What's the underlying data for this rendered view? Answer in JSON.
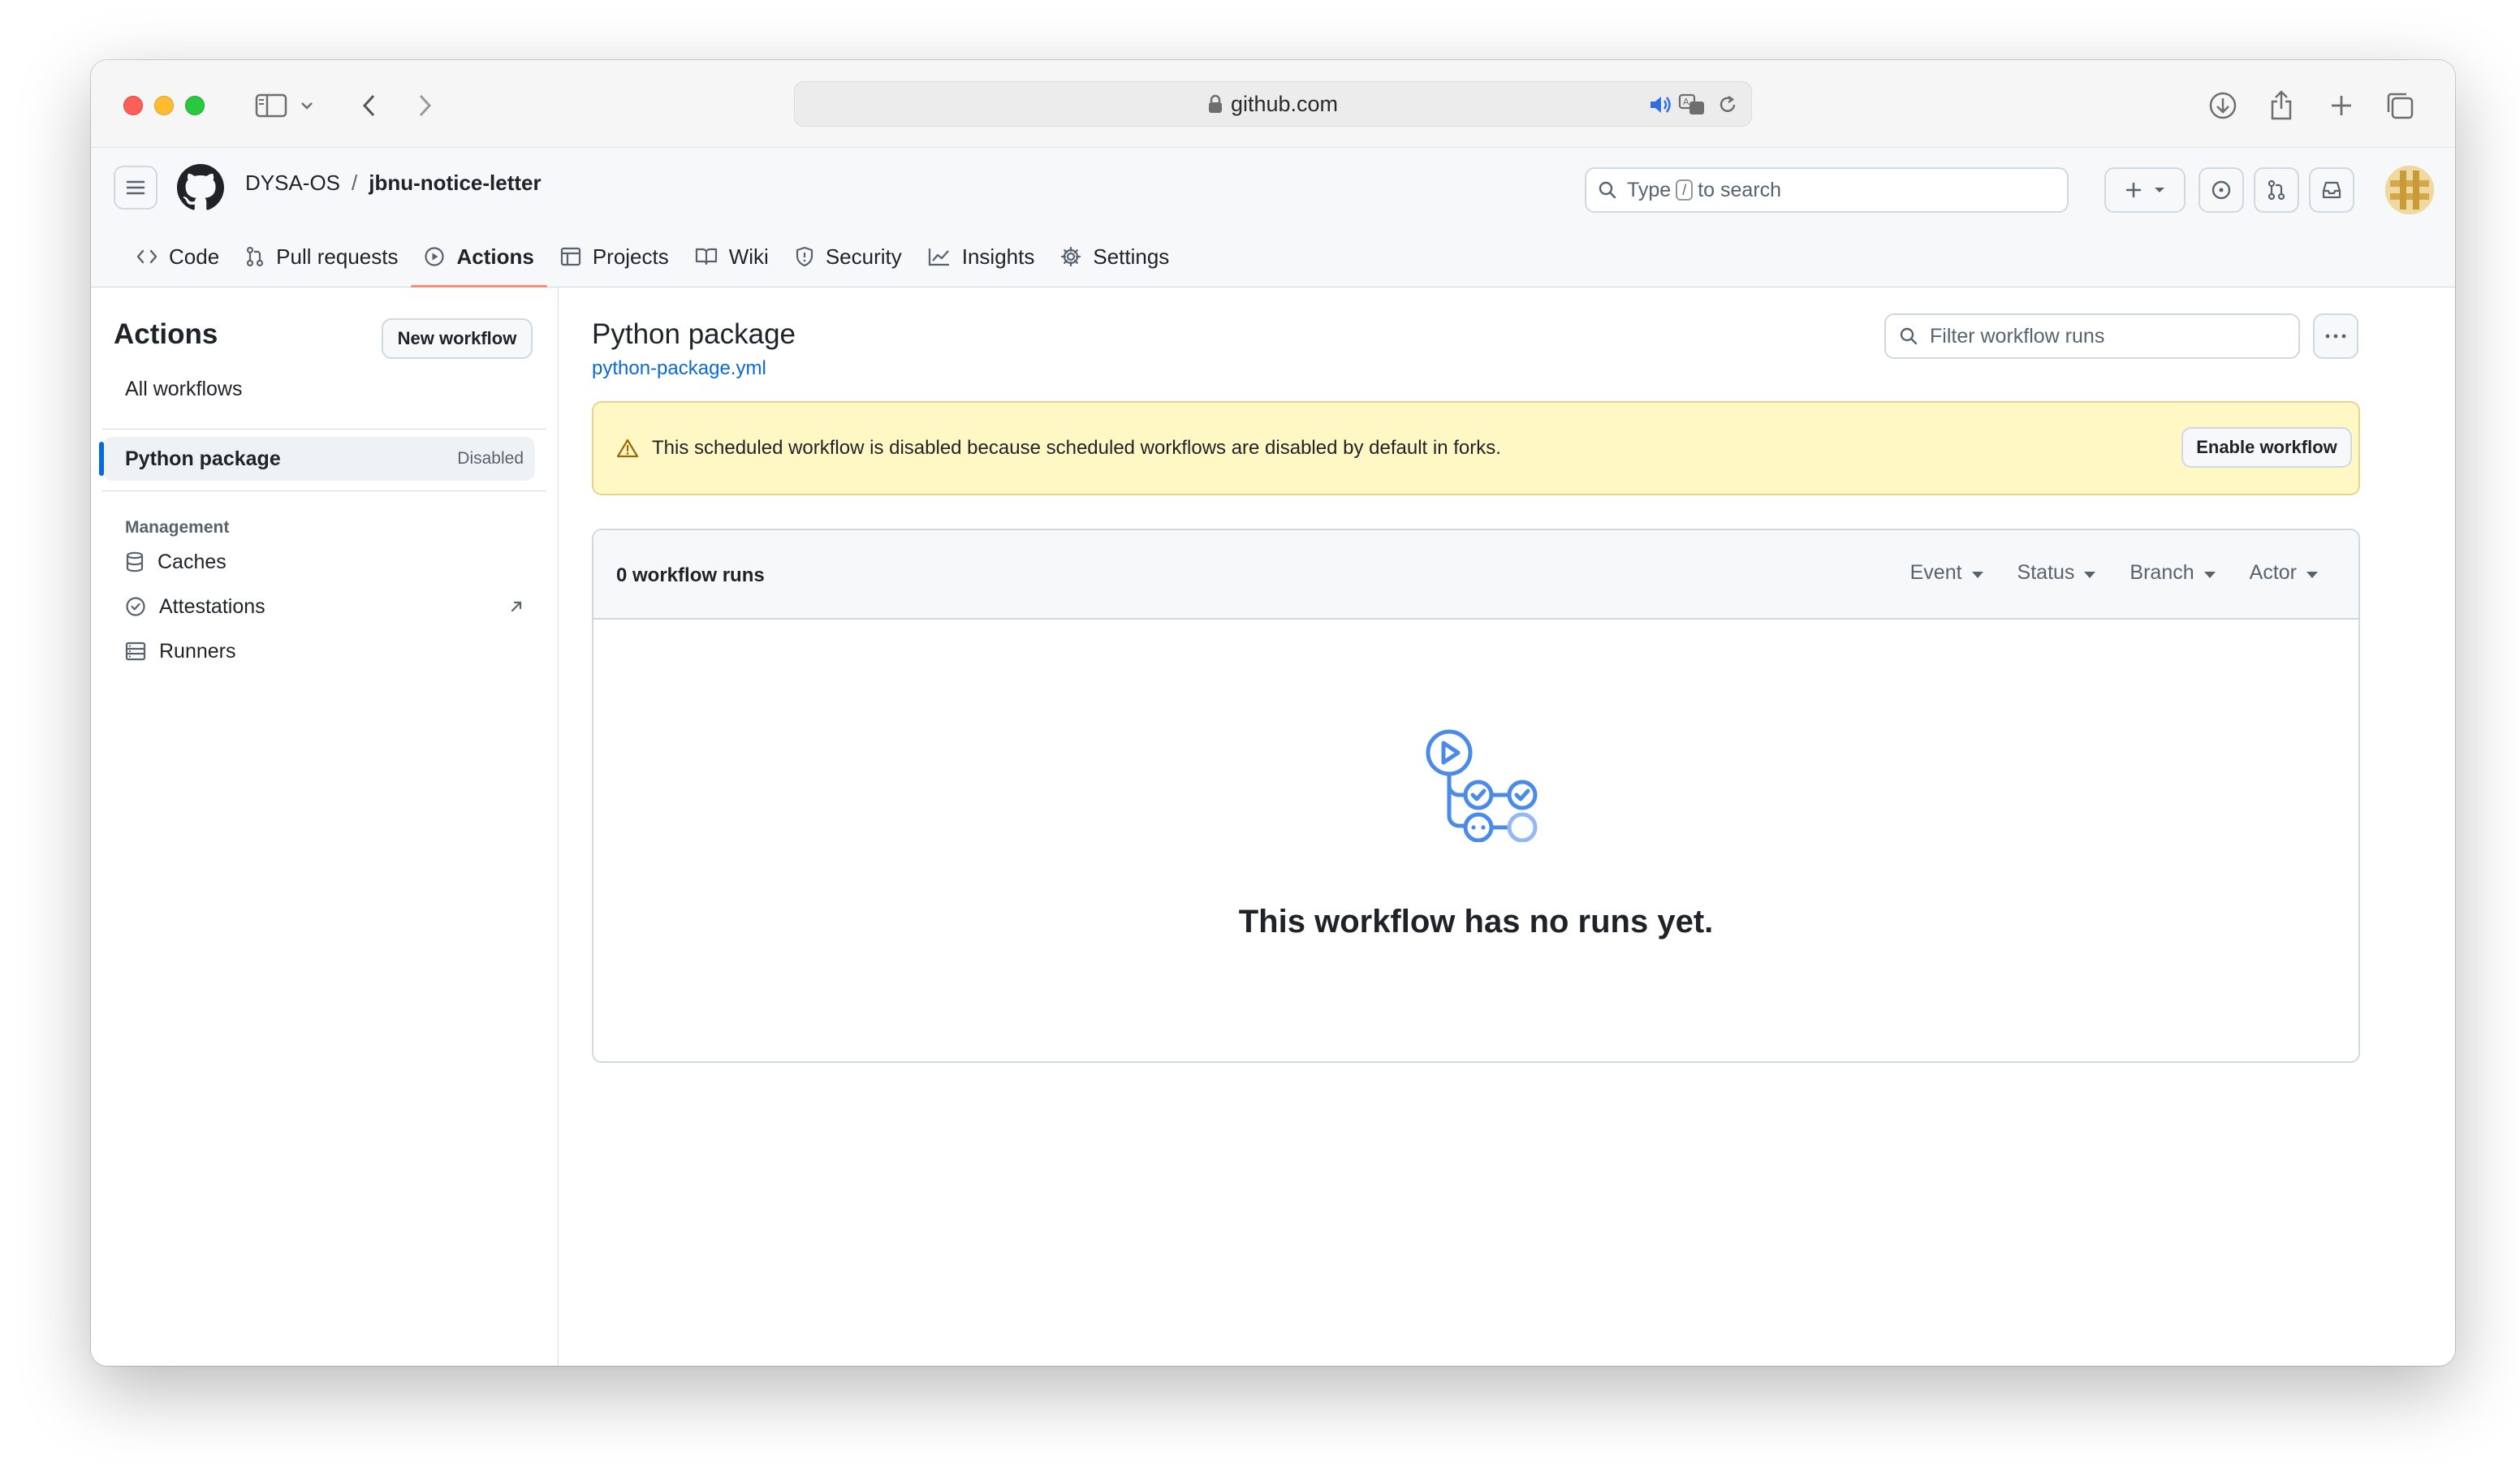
{
  "browser": {
    "url": "github.com"
  },
  "repo": {
    "owner": "DYSA-OS",
    "separator": "/",
    "name": "jbnu-notice-letter"
  },
  "search": {
    "prefix": "Type",
    "key": "/",
    "suffix": "to search"
  },
  "tabs": [
    {
      "label": "Code",
      "icon": "code-icon"
    },
    {
      "label": "Pull requests",
      "icon": "git-pull-request-icon"
    },
    {
      "label": "Actions",
      "icon": "play-icon",
      "active": true
    },
    {
      "label": "Projects",
      "icon": "table-icon"
    },
    {
      "label": "Wiki",
      "icon": "book-icon"
    },
    {
      "label": "Security",
      "icon": "shield-icon"
    },
    {
      "label": "Insights",
      "icon": "graph-icon"
    },
    {
      "label": "Settings",
      "icon": "gear-icon"
    }
  ],
  "sidebar": {
    "title": "Actions",
    "new_workflow": "New workflow",
    "all_workflows": "All workflows",
    "workflow": {
      "label": "Python package",
      "badge": "Disabled"
    },
    "management": {
      "title": "Management",
      "items": [
        {
          "label": "Caches",
          "icon": "database-icon"
        },
        {
          "label": "Attestations",
          "icon": "verified-icon"
        },
        {
          "label": "Runners",
          "icon": "server-icon"
        }
      ]
    }
  },
  "main": {
    "title": "Python package",
    "file": "python-package.yml",
    "filter_placeholder": "Filter workflow runs",
    "flash": {
      "message": "This scheduled workflow is disabled because scheduled workflows are disabled by default in forks.",
      "button": "Enable workflow"
    },
    "runs": {
      "count_label": "0 workflow runs",
      "filters": [
        "Event",
        "Status",
        "Branch",
        "Actor"
      ],
      "empty": "This workflow has no runs yet."
    }
  },
  "colors": {
    "accent": "#0969da",
    "tab_underline": "#fd8c73",
    "flash_bg": "#fff8c5",
    "empty_icon": "#4a8bea"
  }
}
